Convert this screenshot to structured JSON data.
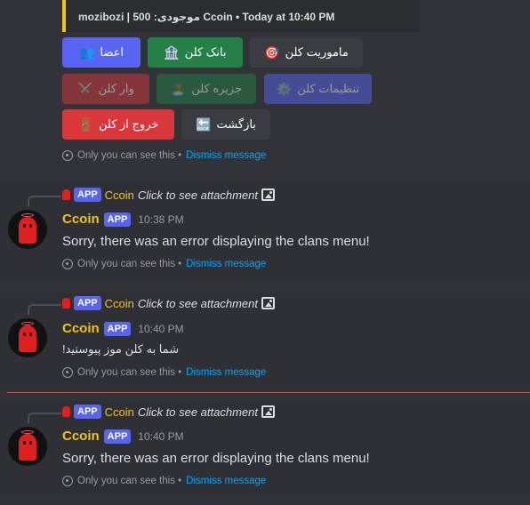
{
  "embed": {
    "footer": "mozibozi | 500 :موجودی Ccoin • Today at 10:40 PM"
  },
  "buttons": [
    {
      "label": "اعضا",
      "icon": "👥"
    },
    {
      "label": "بانک کلن",
      "icon": "🏦"
    },
    {
      "label": "ماموریت کلن",
      "icon": "🎯"
    },
    {
      "label": "وار کلن",
      "icon": "⚔️"
    },
    {
      "label": "جزیره کلن",
      "icon": "🏝️"
    },
    {
      "label": "تنظیمات کلن",
      "icon": "⚙️"
    },
    {
      "label": "خروج از کلن",
      "icon": "🚪"
    },
    {
      "label": "بازگشت",
      "icon": "🔙"
    }
  ],
  "ephemeral": {
    "text": "Only you can see this •",
    "link": "Dismiss message"
  },
  "messages": [
    {
      "reply_badge": "APP",
      "reply_name": "Ccoin",
      "reply_text": "Click to see attachment",
      "username": "Ccoin",
      "badge": "APP",
      "time": "10:38 PM",
      "content": "Sorry, there was an error displaying the clans menu!"
    },
    {
      "reply_badge": "APP",
      "reply_name": "Ccoin",
      "reply_text": "Click to see attachment",
      "username": "Ccoin",
      "badge": "APP",
      "time": "10:40 PM",
      "content": "شما به کلن موز پیوستید!"
    },
    {
      "reply_badge": "APP",
      "reply_name": "Ccoin",
      "reply_text": "Click to see attachment",
      "username": "Ccoin",
      "badge": "APP",
      "time": "10:40 PM",
      "content": "Sorry, there was an error displaying the clans menu!"
    }
  ]
}
